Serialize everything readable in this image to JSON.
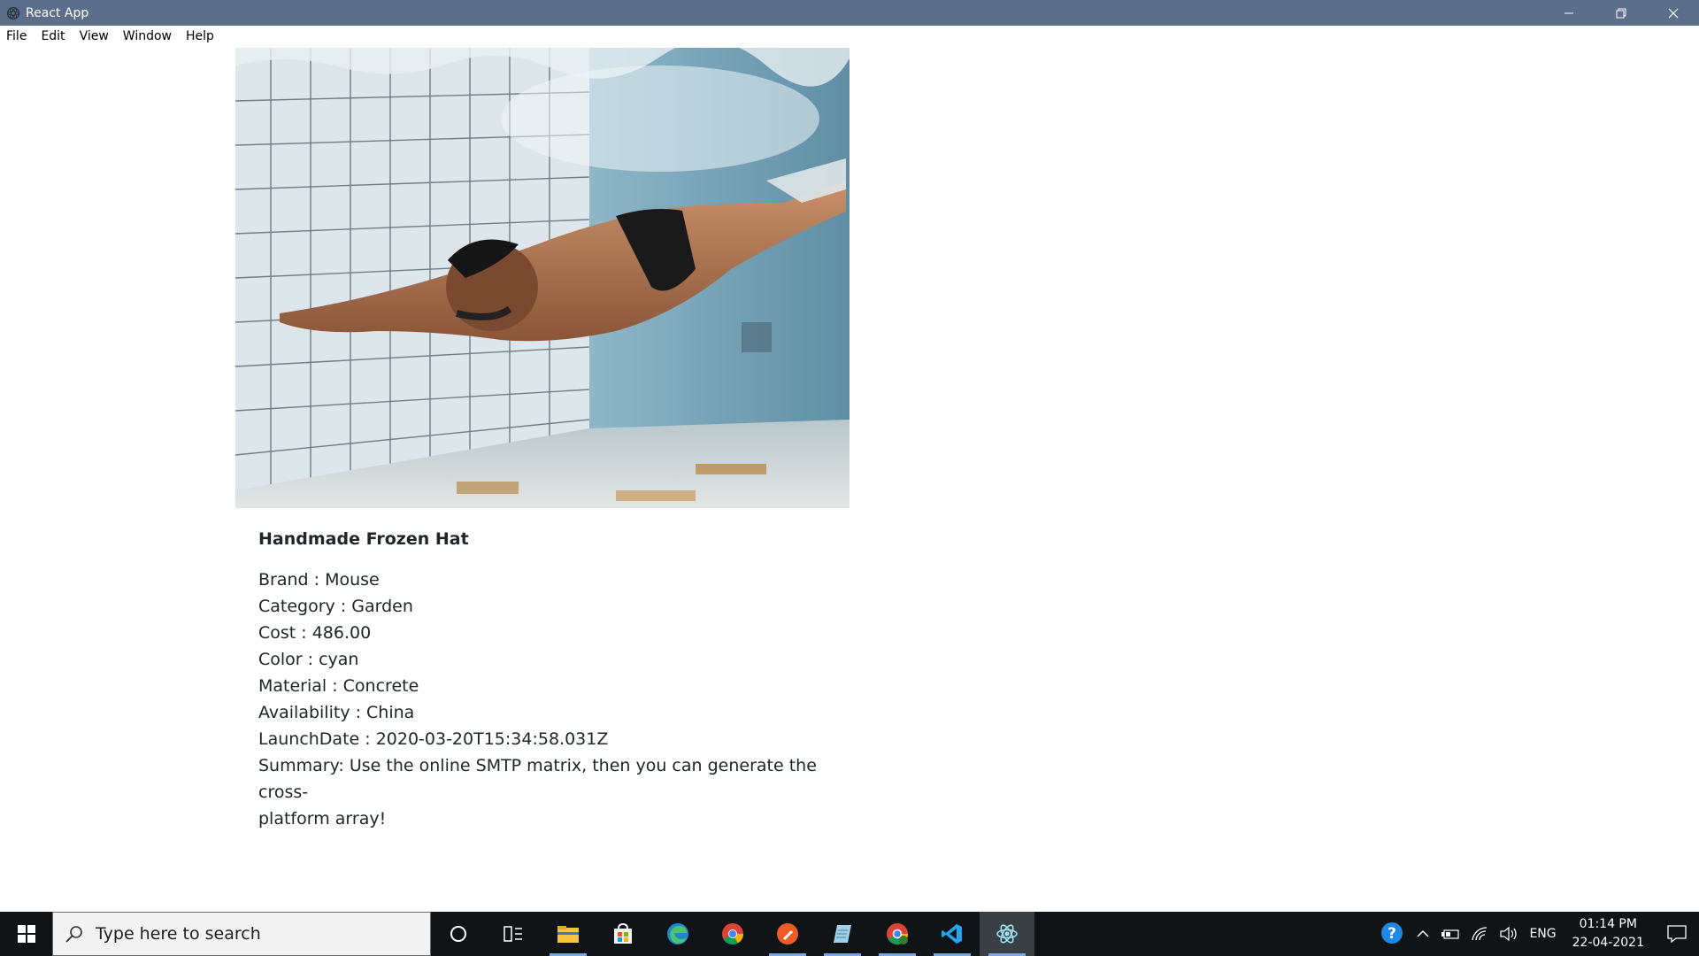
{
  "window": {
    "title": "React App",
    "menu": [
      "File",
      "Edit",
      "View",
      "Window",
      "Help"
    ]
  },
  "product": {
    "title": "Handmade Frozen Hat",
    "attributes": [
      "Brand : Mouse",
      "Category : Garden",
      "Cost : 486.00",
      "Color : cyan",
      "Material : Concrete",
      "Availability : China",
      "LaunchDate : 2020-03-20T15:34:58.031Z"
    ],
    "summary_line1": "Summary: Use the online SMTP matrix, then you can generate the cross-",
    "summary_line2": "platform array!"
  },
  "taskbar": {
    "search_placeholder": "Type here to search",
    "apps": [
      "cortana-icon",
      "task-view-icon",
      "file-explorer-icon",
      "store-icon",
      "edge-icon",
      "chrome-icon",
      "postman-icon",
      "notepad-icon",
      "chrome-profile-icon",
      "vscode-icon",
      "electron-icon"
    ],
    "tray": {
      "language": "ENG",
      "time": "01:14 PM",
      "date": "22-04-2021"
    }
  },
  "colors": {
    "titlebar": "#5b6e8a",
    "taskbar": "#111417",
    "text": "#212529"
  }
}
